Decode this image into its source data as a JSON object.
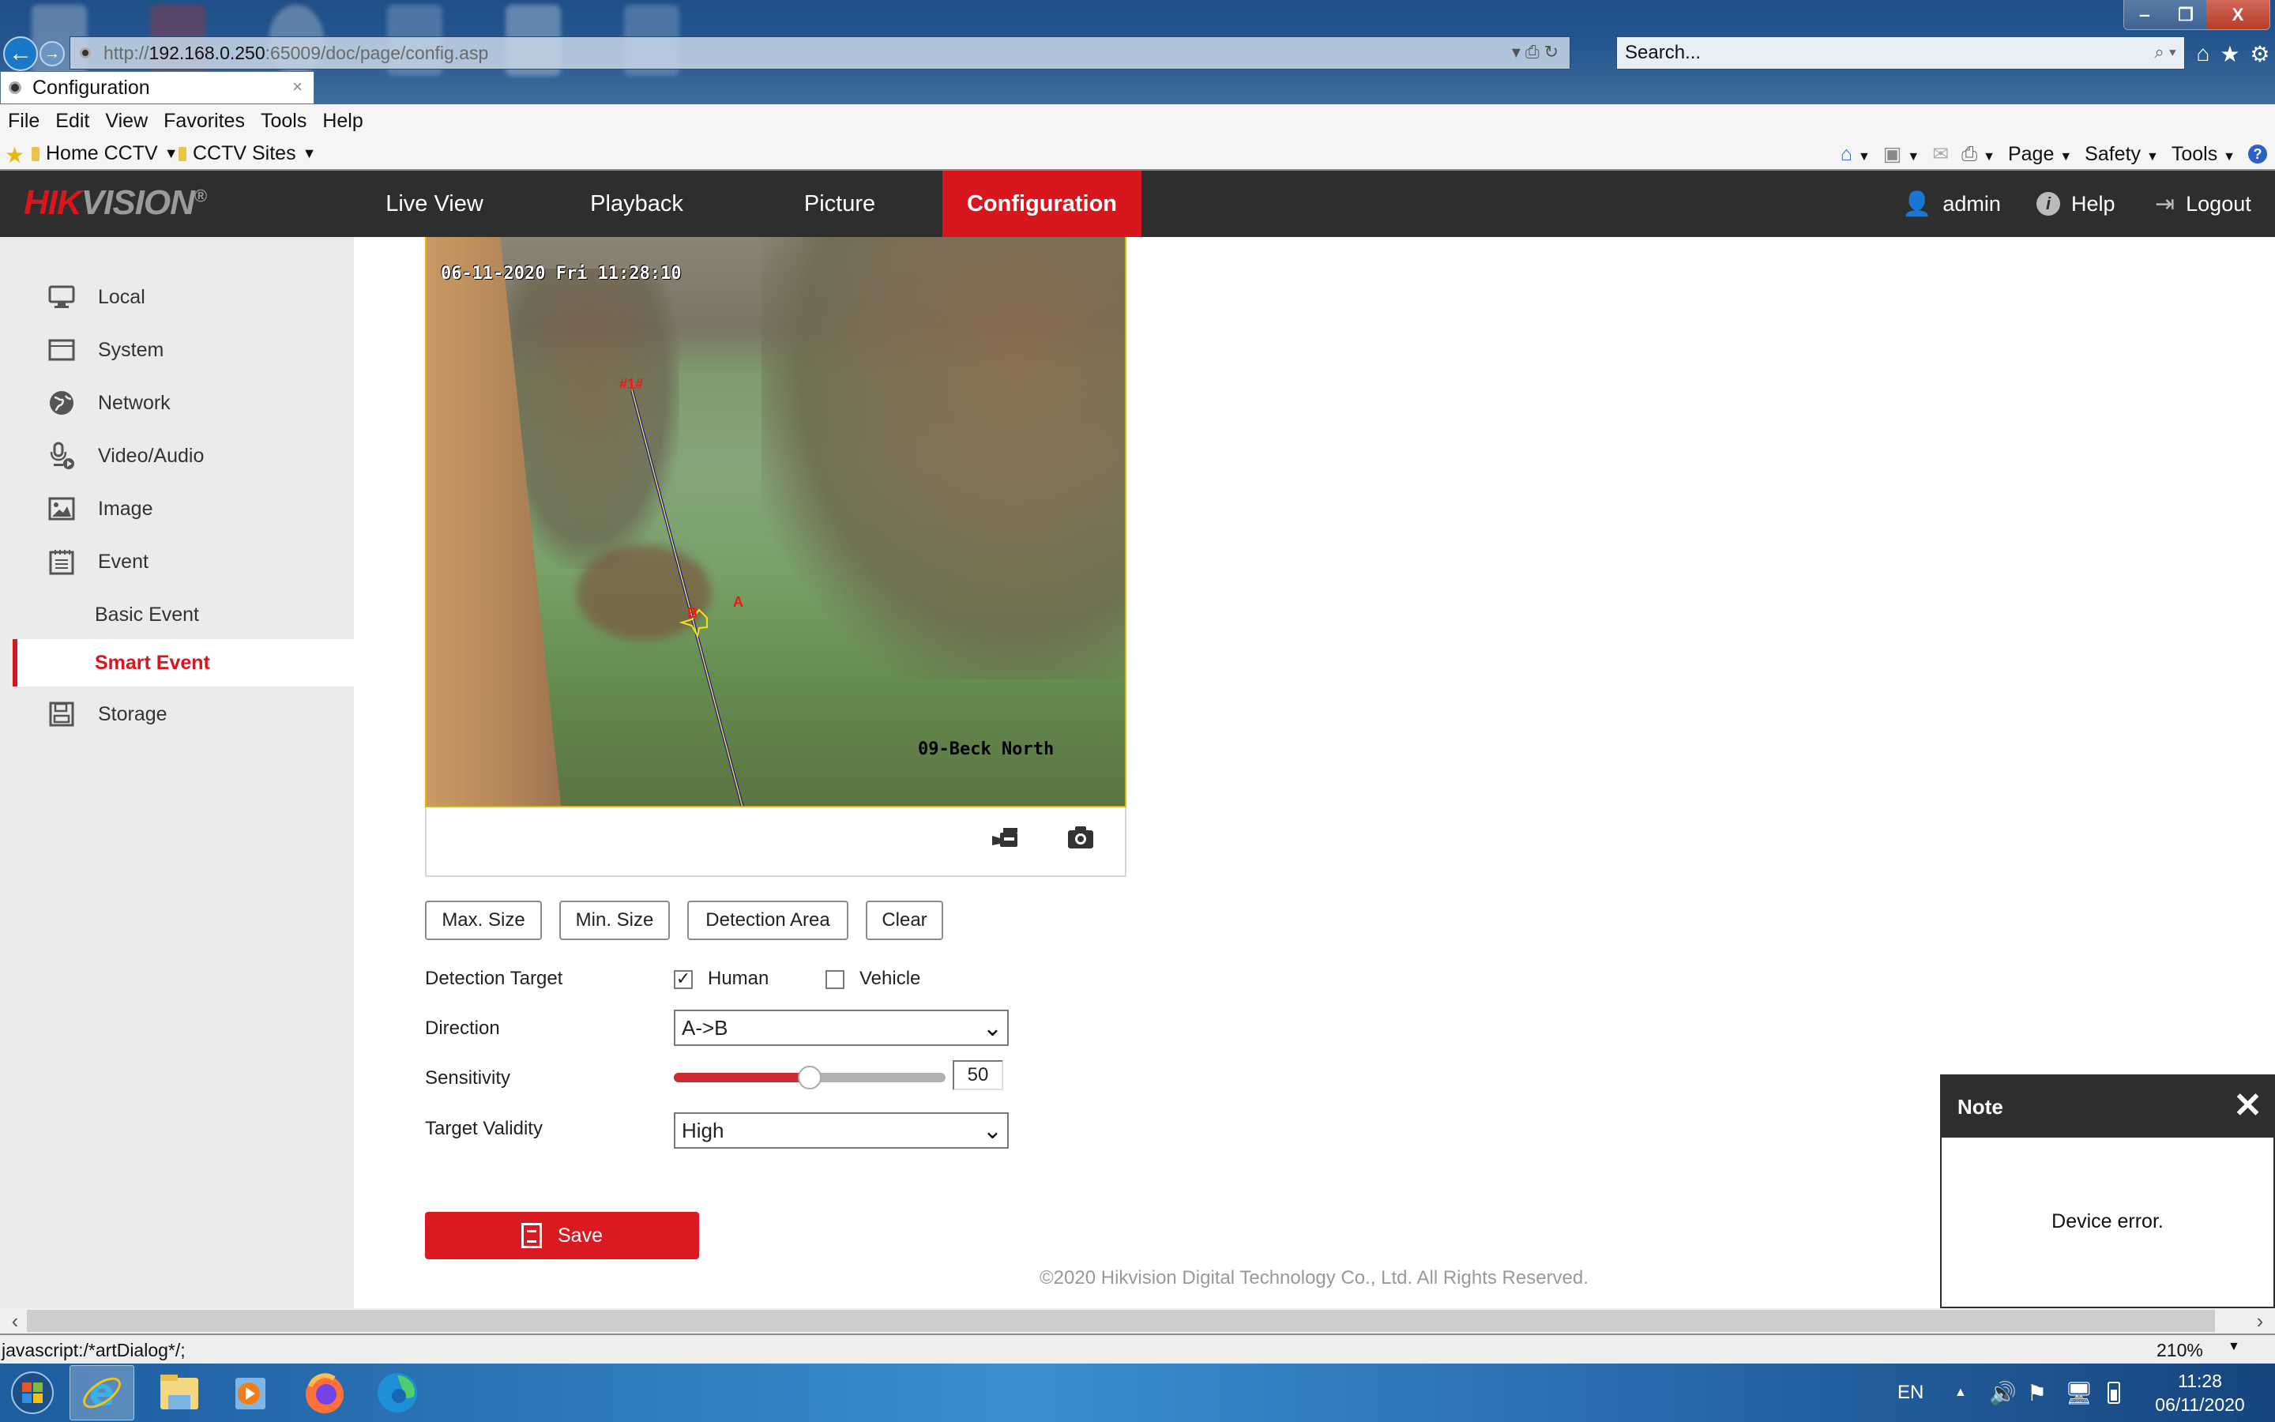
{
  "browser": {
    "url_prefix": "http://",
    "url_host": "192.168.0.250",
    "url_rest": ":65009/doc/page/config.asp",
    "search_placeholder": "Search...",
    "tab_title": "Configuration",
    "tab_close": "×",
    "menu": [
      "File",
      "Edit",
      "View",
      "Favorites",
      "Tools",
      "Help"
    ],
    "favorites": [
      {
        "label": "Home CCTV"
      },
      {
        "label": "CCTV Sites"
      }
    ],
    "command_bar": [
      "Page",
      "Safety",
      "Tools"
    ],
    "window_buttons": {
      "minimize": "‒",
      "restore": "❐",
      "close": "X"
    },
    "status_text": "javascript:/*artDialog*/;",
    "zoom_level": "210%"
  },
  "app": {
    "logo_red": "HIK",
    "logo_gray": "VISION",
    "logo_reg": "®",
    "nav": [
      {
        "label": "Live View",
        "active": false
      },
      {
        "label": "Playback",
        "active": false
      },
      {
        "label": "Picture",
        "active": false
      },
      {
        "label": "Configuration",
        "active": true
      }
    ],
    "user": "admin",
    "help": "Help",
    "logout": "Logout",
    "accent_color": "#d7161e"
  },
  "sidebar": {
    "items": [
      {
        "label": "Local",
        "icon": "monitor-icon"
      },
      {
        "label": "System",
        "icon": "window-icon"
      },
      {
        "label": "Network",
        "icon": "globe-icon"
      },
      {
        "label": "Video/Audio",
        "icon": "microphone-video-icon"
      },
      {
        "label": "Image",
        "icon": "image-icon"
      },
      {
        "label": "Event",
        "icon": "calendar-icon"
      }
    ],
    "sub_items": [
      {
        "label": "Basic Event",
        "active": false
      },
      {
        "label": "Smart Event",
        "active": true
      }
    ],
    "storage": {
      "label": "Storage",
      "icon": "floppy-disk-icon"
    }
  },
  "camera": {
    "osd_timestamp": "06-11-2020 Fri 11:28:10",
    "osd_name": "09-Beck North",
    "rule_label": "#1#",
    "side_a": "A",
    "side_b": "B"
  },
  "form": {
    "buttons": [
      "Max. Size",
      "Min. Size",
      "Detection Area",
      "Clear"
    ],
    "detection_target_label": "Detection Target",
    "targets": [
      {
        "label": "Human",
        "checked": true
      },
      {
        "label": "Vehicle",
        "checked": false
      }
    ],
    "direction_label": "Direction",
    "direction_value": "A->B",
    "sensitivity_label": "Sensitivity",
    "sensitivity_value": "50",
    "sensitivity_percent": 50,
    "target_validity_label": "Target Validity",
    "target_validity_value": "High",
    "save_label": "Save"
  },
  "footer": {
    "copyright": "©2020 Hikvision Digital Technology Co., Ltd. All Rights Reserved."
  },
  "dialog": {
    "title": "Note",
    "message": "Device error."
  },
  "taskbar": {
    "language": "EN",
    "time": "11:28",
    "date": "06/11/2020"
  }
}
